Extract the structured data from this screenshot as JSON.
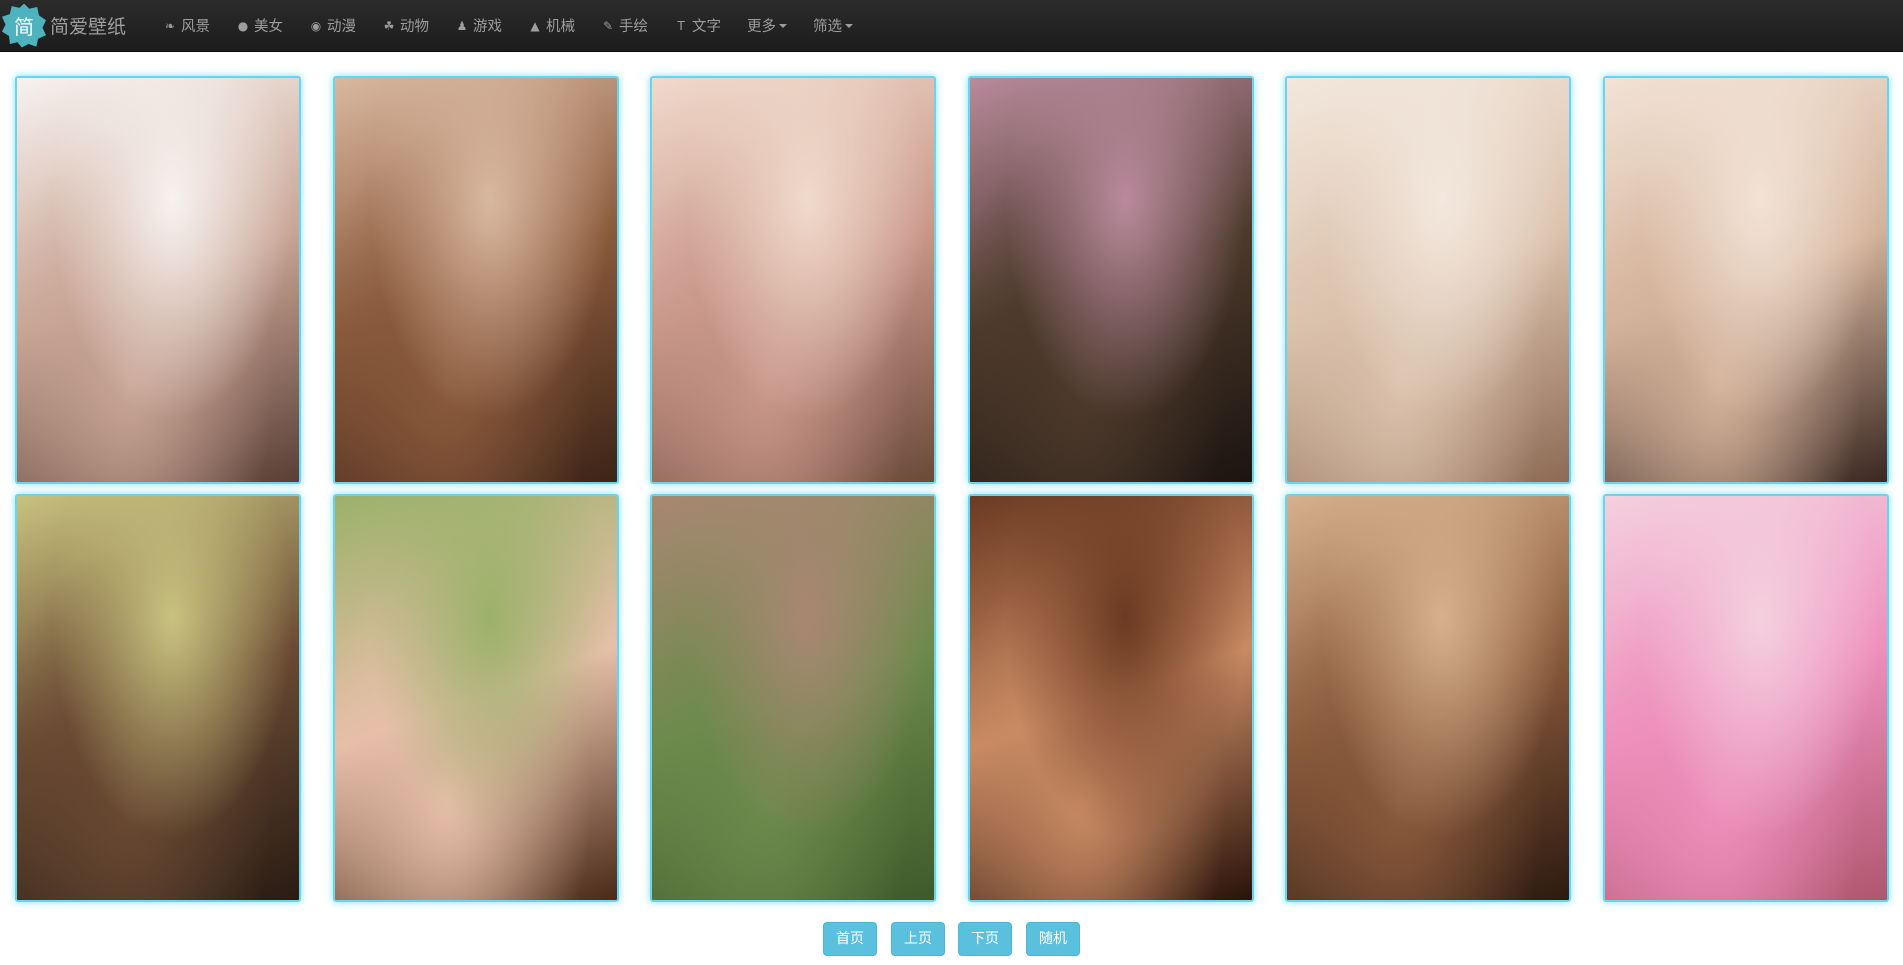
{
  "brand": {
    "logo_char": "简",
    "name": "简爱壁纸"
  },
  "nav": {
    "items": [
      {
        "label": "风景",
        "icon": "leaf-icon",
        "glyph": "❧"
      },
      {
        "label": "美女",
        "icon": "apple-icon",
        "glyph": "●"
      },
      {
        "label": "动漫",
        "icon": "eye-icon",
        "glyph": "◉"
      },
      {
        "label": "动物",
        "icon": "paw-icon",
        "glyph": "☘"
      },
      {
        "label": "游戏",
        "icon": "pawn-icon",
        "glyph": "♟"
      },
      {
        "label": "机械",
        "icon": "tent-icon",
        "glyph": "▲"
      },
      {
        "label": "手绘",
        "icon": "paint-brush-icon",
        "glyph": "✎"
      },
      {
        "label": "文字",
        "icon": "text-height-icon",
        "glyph": "T"
      }
    ],
    "more_label": "更多",
    "filter_label": "筛选"
  },
  "colors": {
    "navbar": "#222222",
    "nav_text": "#9d9d9d",
    "logo_bg": "#4fb3bf",
    "card_border": "#6ad4ee",
    "pager_btn": "#5bc0de"
  },
  "gallery": {
    "photos": [
      {
        "palette": [
          "#f7f2ef",
          "#c9a595",
          "#5a3f36"
        ]
      },
      {
        "palette": [
          "#d9b8a0",
          "#8b5a3c",
          "#3d2417"
        ]
      },
      {
        "palette": [
          "#f0dacb",
          "#c9978a",
          "#6b4a3a"
        ]
      },
      {
        "palette": [
          "#b98a9c",
          "#4d3a2c",
          "#1c140f"
        ]
      },
      {
        "palette": [
          "#f3e8de",
          "#dbc2ac",
          "#8d6a55"
        ]
      },
      {
        "palette": [
          "#f2e3d6",
          "#d4b29a",
          "#3a2822"
        ]
      },
      {
        "palette": [
          "#c8c27e",
          "#6a4a33",
          "#2a1c14"
        ]
      },
      {
        "palette": [
          "#9bb16a",
          "#e7bfa9",
          "#4a2a18"
        ]
      },
      {
        "palette": [
          "#a98772",
          "#6d8a4c",
          "#3f5a2a"
        ]
      },
      {
        "palette": [
          "#6b3a22",
          "#c98a63",
          "#2a130a"
        ]
      },
      {
        "palette": [
          "#d6b18c",
          "#8a5a3c",
          "#2d1a10"
        ]
      },
      {
        "palette": [
          "#f4d0de",
          "#ee8fbc",
          "#b0566f"
        ]
      }
    ]
  },
  "pager": {
    "first": "首页",
    "prev": "上页",
    "next": "下页",
    "random": "随机"
  }
}
